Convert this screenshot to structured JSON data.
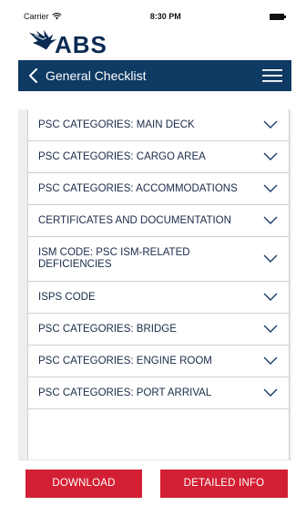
{
  "status_bar": {
    "carrier": "Carrier",
    "time": "8:30 PM"
  },
  "logo": {
    "text": "ABS"
  },
  "nav": {
    "title": "General Checklist"
  },
  "checklist": {
    "items": [
      {
        "label": "PSC CATEGORIES: MAIN DECK"
      },
      {
        "label": "PSC CATEGORIES: CARGO AREA"
      },
      {
        "label": "PSC CATEGORIES: ACCOMMODATIONS"
      },
      {
        "label": "CERTIFICATES AND DOCUMENTATION"
      },
      {
        "label": "ISM CODE: PSC ISM-RELATED DEFICIENCIES"
      },
      {
        "label": "ISPS CODE"
      },
      {
        "label": "PSC CATEGORIES: BRIDGE"
      },
      {
        "label": "PSC CATEGORIES: ENGINE ROOM"
      },
      {
        "label": "PSC CATEGORIES: PORT ARRIVAL"
      }
    ]
  },
  "actions": {
    "download_label": "DOWNLOAD",
    "detailed_info_label": "DETAILED INFO"
  },
  "colors": {
    "nav_background": "#0e3a64",
    "action_red": "#d31f33",
    "logo_navy": "#0b2b52"
  }
}
